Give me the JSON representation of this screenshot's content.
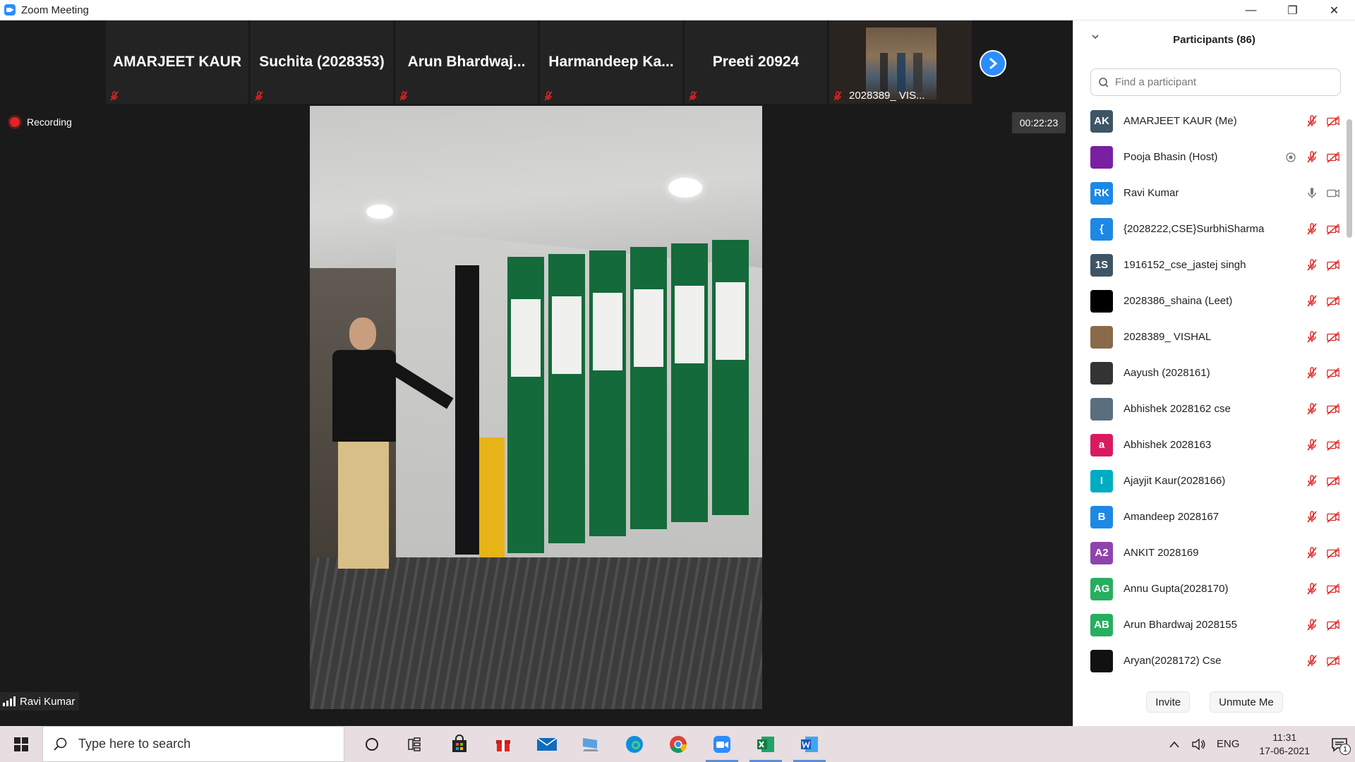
{
  "window": {
    "title": "Zoom Meeting",
    "minimize": "—",
    "restore": "❐",
    "close": "✕"
  },
  "colors": {
    "accent": "#2d8cff",
    "muted_red": "#e02424",
    "panel_bg": "#ffffff",
    "meeting_bg": "#1a1a1a"
  },
  "thumbnails": [
    {
      "name": "AMARJEET KAUR"
    },
    {
      "name": "Suchita (2028353)"
    },
    {
      "name": "Arun  Bhardwaj..."
    },
    {
      "name": "Harmandeep  Ka..."
    },
    {
      "name": "Preeti 20924"
    },
    {
      "name": "2028389_ VIS..."
    }
  ],
  "next_icon": "chevron-right",
  "recording": {
    "label": "Recording"
  },
  "timer": "00:22:23",
  "active_speaker": {
    "name": "Ravi Kumar"
  },
  "participants_panel": {
    "title": "Participants (86)",
    "search_placeholder": "Find a participant",
    "invite_label": "Invite",
    "unmute_label": "Unmute Me",
    "participants": [
      {
        "initials": "AK",
        "name": "AMARJEET KAUR (Me)",
        "color": "#3e5566",
        "muted": true
      },
      {
        "initials": "",
        "name": "Pooja Bhasin (Host)",
        "color": "#7b1fa2",
        "muted": true,
        "recording": true
      },
      {
        "initials": "RK",
        "name": "Ravi Kumar",
        "color": "#1e88e5",
        "muted": false
      },
      {
        "initials": "{",
        "name": "{2028222,CSE}SurbhiSharma",
        "color": "#1e88e5",
        "muted": true
      },
      {
        "initials": "1S",
        "name": "1916152_cse_jastej singh",
        "color": "#3e5566",
        "muted": true
      },
      {
        "initials": "",
        "name": "2028386_shaina (Leet)",
        "color": "#000000",
        "muted": true
      },
      {
        "initials": "",
        "name": "2028389_ VISHAL",
        "color": "#8a6a4a",
        "muted": true
      },
      {
        "initials": "",
        "name": "Aayush (2028161)",
        "color": "#333333",
        "muted": true
      },
      {
        "initials": "",
        "name": "Abhishek 2028162 cse",
        "color": "#5a6e7e",
        "muted": true
      },
      {
        "initials": "a",
        "name": "Abhishek 2028163",
        "color": "#d81b60",
        "muted": true
      },
      {
        "initials": "I",
        "name": "Ajayjit Kaur(2028166)",
        "color": "#00acc1",
        "muted": true
      },
      {
        "initials": "B",
        "name": "Amandeep 2028167",
        "color": "#1e88e5",
        "muted": true
      },
      {
        "initials": "A2",
        "name": "ANKIT 2028169",
        "color": "#8e44ad",
        "muted": true
      },
      {
        "initials": "AG",
        "name": "Annu Gupta(2028170)",
        "color": "#27ae60",
        "muted": true
      },
      {
        "initials": "AB",
        "name": "Arun Bhardwaj 2028155",
        "color": "#27ae60",
        "muted": true
      },
      {
        "initials": "",
        "name": "Aryan(2028172) Cse",
        "color": "#111111",
        "muted": true
      }
    ]
  },
  "taskbar": {
    "search_placeholder": "Type here to search",
    "language": "ENG",
    "time": "11:31",
    "date": "17-06-2021",
    "notification_count": "1"
  }
}
